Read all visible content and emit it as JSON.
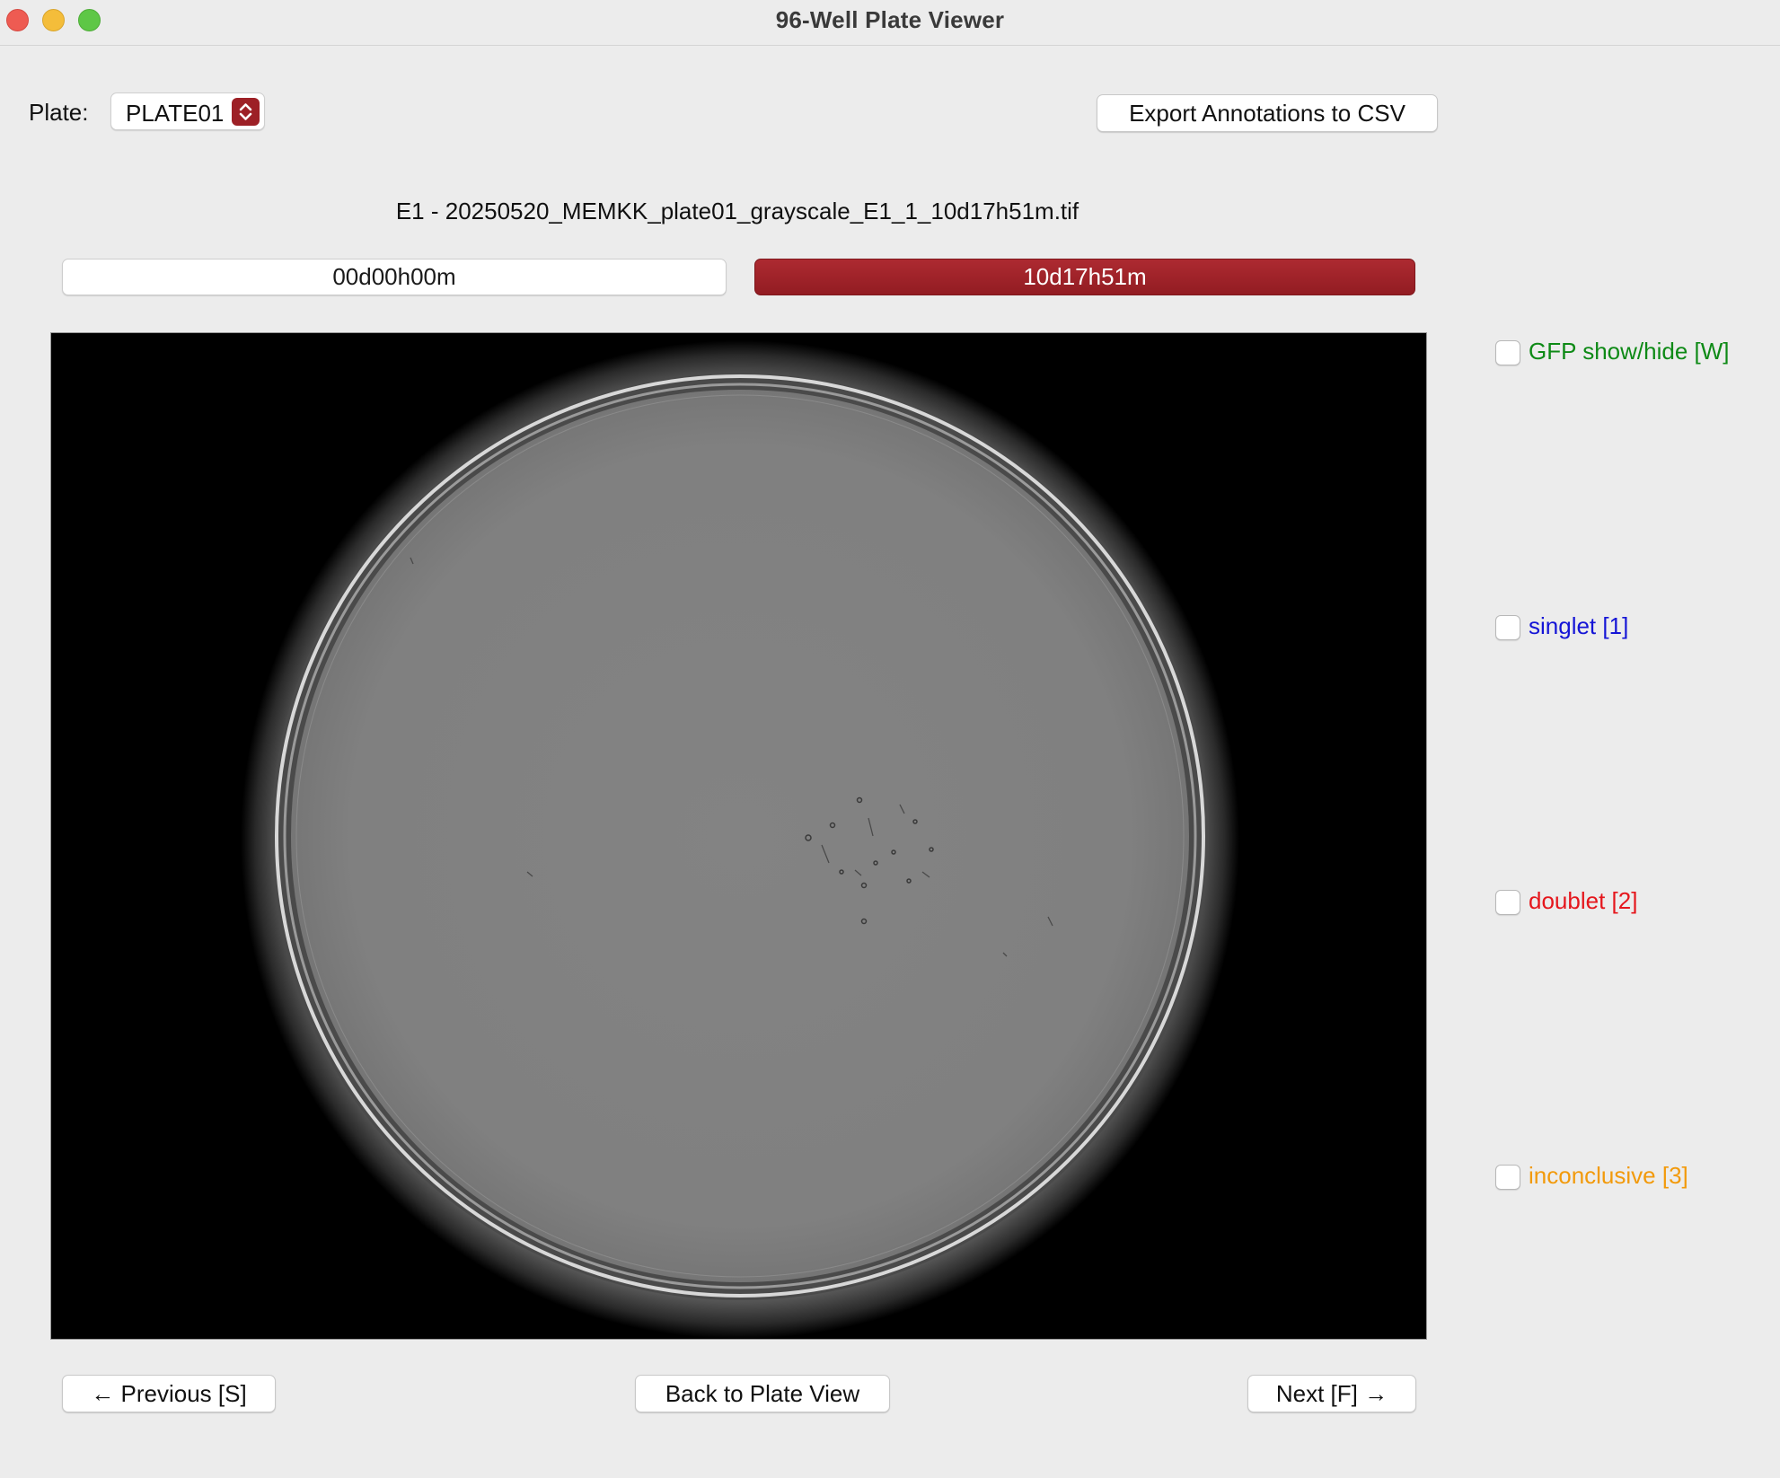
{
  "window": {
    "title": "96-Well Plate Viewer"
  },
  "toolbar": {
    "plate_label": "Plate:",
    "plate_selected": "PLATE01",
    "export_label": "Export Annotations to CSV"
  },
  "image": {
    "title": "E1 - 20250520_MEMKK_plate01_grayscale_E1_1_10d17h51m.tif"
  },
  "timepoints": [
    {
      "label": "00d00h00m",
      "selected": false
    },
    {
      "label": "10d17h51m",
      "selected": true
    }
  ],
  "annotations": [
    {
      "label": "GFP show/hide [W]",
      "color": "#0e8a16",
      "checked": false
    },
    {
      "label": "singlet [1]",
      "color": "#1515d6",
      "checked": false
    },
    {
      "label": "doublet [2]",
      "color": "#e5161c",
      "checked": false
    },
    {
      "label": "inconclusive [3]",
      "color": "#f29a0b",
      "checked": false
    }
  ],
  "navigation": {
    "previous_label": "← Previous [S]",
    "back_label": "Back to Plate View",
    "next_label": "Next [F] →"
  },
  "colors": {
    "accent": "#9d2026",
    "background": "#ececec"
  }
}
